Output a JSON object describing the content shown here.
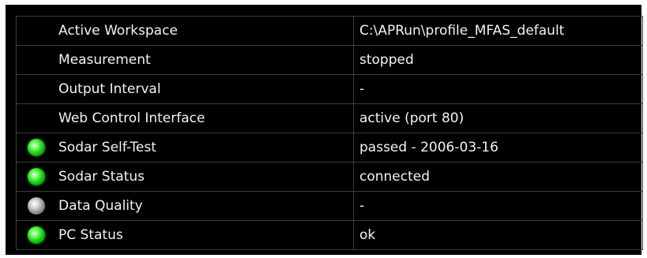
{
  "status_table": {
    "rows": [
      {
        "label": "Active Workspace",
        "value": "C:\\APRun\\profile_MFAS_default",
        "indicator": "none"
      },
      {
        "label": "Measurement",
        "value": "stopped",
        "indicator": "none"
      },
      {
        "label": "Output Interval",
        "value": "-",
        "indicator": "none"
      },
      {
        "label": "Web Control Interface",
        "value": "active (port 80)",
        "indicator": "none"
      },
      {
        "label": "Sodar Self-Test",
        "value": "passed - 2006-03-16",
        "indicator": "green"
      },
      {
        "label": "Sodar Status",
        "value": "connected",
        "indicator": "green"
      },
      {
        "label": "Data Quality",
        "value": "-",
        "indicator": "gray"
      },
      {
        "label": "PC Status",
        "value": "ok",
        "indicator": "green"
      }
    ]
  },
  "colors": {
    "background": "#000000",
    "grid_line": "#3c3c3c",
    "text": "#f2f2f2",
    "indicator_green": "#1fd51b",
    "indicator_gray": "#9a9a9a"
  },
  "icons": {
    "green": "status-ok-led-icon",
    "gray": "status-unknown-led-icon"
  }
}
